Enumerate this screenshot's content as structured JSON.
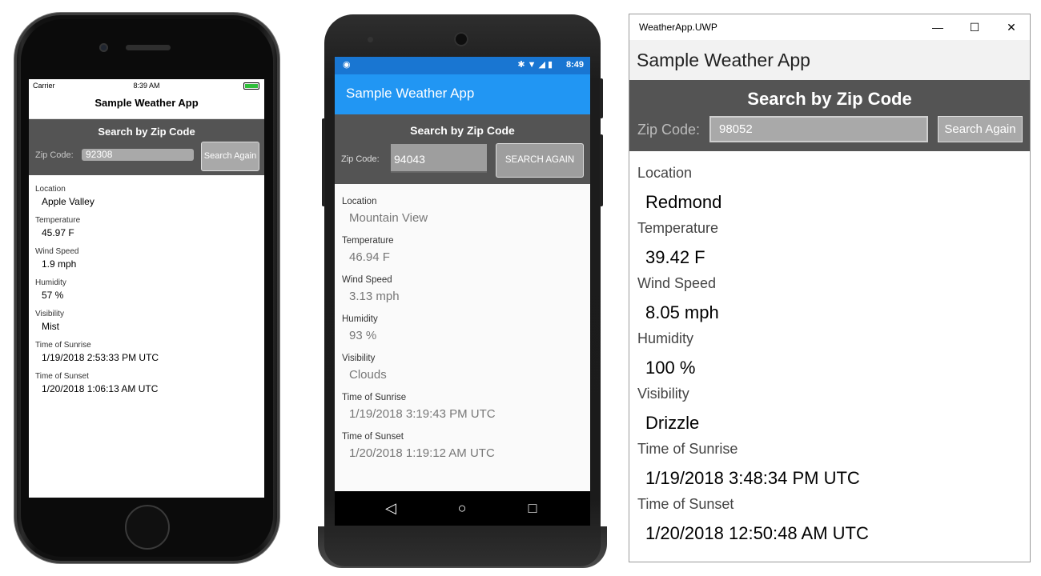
{
  "ios": {
    "status": {
      "carrier": "Carrier",
      "time": "8:39 AM"
    },
    "nav_title": "Sample Weather App",
    "search_title": "Search by Zip Code",
    "zip_label": "Zip Code:",
    "zip_value": "92308",
    "button_label": "Search Again",
    "results": [
      {
        "label": "Location",
        "value": "Apple Valley"
      },
      {
        "label": "Temperature",
        "value": "45.97 F"
      },
      {
        "label": "Wind Speed",
        "value": "1.9 mph"
      },
      {
        "label": "Humidity",
        "value": "57 %"
      },
      {
        "label": "Visibility",
        "value": "Mist"
      },
      {
        "label": "Time of Sunrise",
        "value": "1/19/2018 2:53:33 PM UTC"
      },
      {
        "label": "Time of Sunset",
        "value": "1/20/2018 1:06:13 AM UTC"
      }
    ]
  },
  "android": {
    "status": {
      "time": "8:49"
    },
    "app_title": "Sample Weather App",
    "search_title": "Search by Zip Code",
    "zip_label": "Zip Code:",
    "zip_value": "94043",
    "button_label": "SEARCH AGAIN",
    "results": [
      {
        "label": "Location",
        "value": "Mountain View"
      },
      {
        "label": "Temperature",
        "value": "46.94 F"
      },
      {
        "label": "Wind Speed",
        "value": "3.13 mph"
      },
      {
        "label": "Humidity",
        "value": "93 %"
      },
      {
        "label": "Visibility",
        "value": "Clouds"
      },
      {
        "label": "Time of Sunrise",
        "value": "1/19/2018 3:19:43 PM UTC"
      },
      {
        "label": "Time of Sunset",
        "value": "1/20/2018 1:19:12 AM UTC"
      }
    ],
    "colors": {
      "appbar": "#2196f3",
      "statusbar": "#1976d2"
    }
  },
  "uwp": {
    "window_title": "WeatherApp.UWP",
    "header": "Sample Weather App",
    "search_title": "Search by Zip Code",
    "zip_label": "Zip Code:",
    "zip_value": "98052",
    "button_label": "Search Again",
    "results": [
      {
        "label": "Location",
        "value": "Redmond"
      },
      {
        "label": "Temperature",
        "value": "39.42 F"
      },
      {
        "label": "Wind Speed",
        "value": "8.05 mph"
      },
      {
        "label": "Humidity",
        "value": "100 %"
      },
      {
        "label": "Visibility",
        "value": "Drizzle"
      },
      {
        "label": "Time of Sunrise",
        "value": "1/19/2018 3:48:34 PM UTC"
      },
      {
        "label": "Time of Sunset",
        "value": "1/20/2018 12:50:48 AM UTC"
      }
    ]
  },
  "colors": {
    "search_panel": "#545454",
    "input_bg": "#a9a9a9"
  }
}
